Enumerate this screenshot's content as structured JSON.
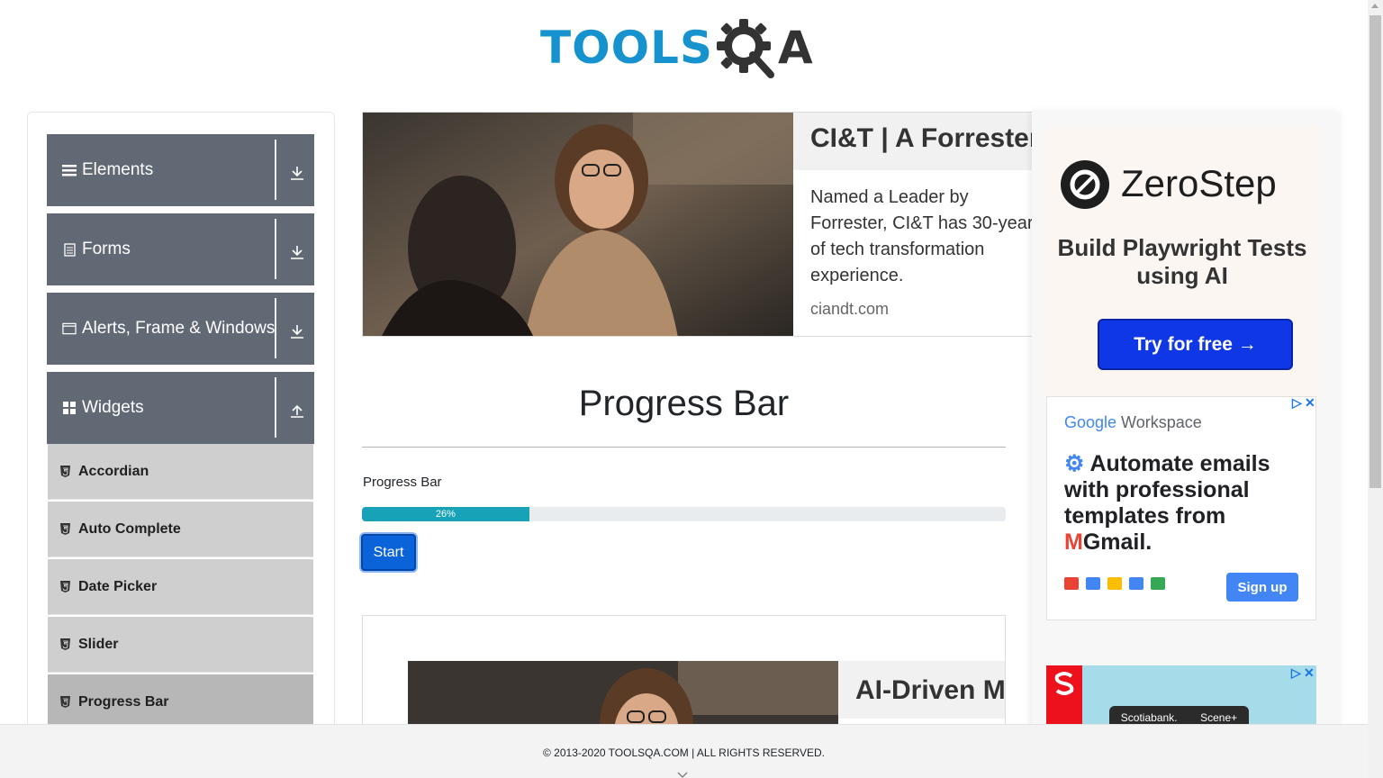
{
  "header": {
    "logo_tools": "TOOLS",
    "logo_a": "A",
    "logo_alt": "TOOLSQA"
  },
  "sidebar": {
    "groups": [
      {
        "label": "Elements",
        "icon": "hamburger-icon",
        "toggle": "download-arrow-icon"
      },
      {
        "label": "Forms",
        "icon": "document-icon",
        "toggle": "download-arrow-icon"
      },
      {
        "label": "Alerts, Frame & Windows",
        "icon": "window-icon",
        "toggle": "download-arrow-icon"
      },
      {
        "label": "Widgets",
        "icon": "grid-icon",
        "toggle": "upload-arrow-icon"
      }
    ],
    "widget_items": [
      {
        "label": "Accordian",
        "icon": "html5-icon"
      },
      {
        "label": "Auto Complete",
        "icon": "html5-icon"
      },
      {
        "label": "Date Picker",
        "icon": "html5-icon"
      },
      {
        "label": "Slider",
        "icon": "html5-icon"
      },
      {
        "label": "Progress Bar",
        "icon": "html5-icon",
        "active": true
      }
    ]
  },
  "ad_top": {
    "headline": "CI&T | A Forrester",
    "body": "Named a Leader by Forrester, CI&T has 30-year of tech transformation experience.",
    "domain": "ciandt.com"
  },
  "main": {
    "title": "Progress Bar",
    "progress_label": "Progress Bar",
    "progress_value": 26,
    "progress_text": "26%",
    "start_button": "Start",
    "colors": {
      "progress_fill": "#17a2b8",
      "button": "#0a63d9"
    }
  },
  "ad_bottom": {
    "headline": "AI-Driven Mod"
  },
  "right_ads": {
    "zerostep": {
      "name": "ZeroStep",
      "tagline": "Build Playwright Tests using AI",
      "button": "Try for free →"
    },
    "google": {
      "brand_google": "Google",
      "brand_workspace": " Workspace",
      "text": "Automate emails with professional templates from",
      "gmail": "Gmail.",
      "button": "Sign up"
    },
    "scotiabank": {
      "brand": "Scotiabank.",
      "partner": "Scene+"
    }
  },
  "footer": {
    "text": "© 2013-2020 TOOLSQA.COM | ALL RIGHTS RESERVED."
  }
}
